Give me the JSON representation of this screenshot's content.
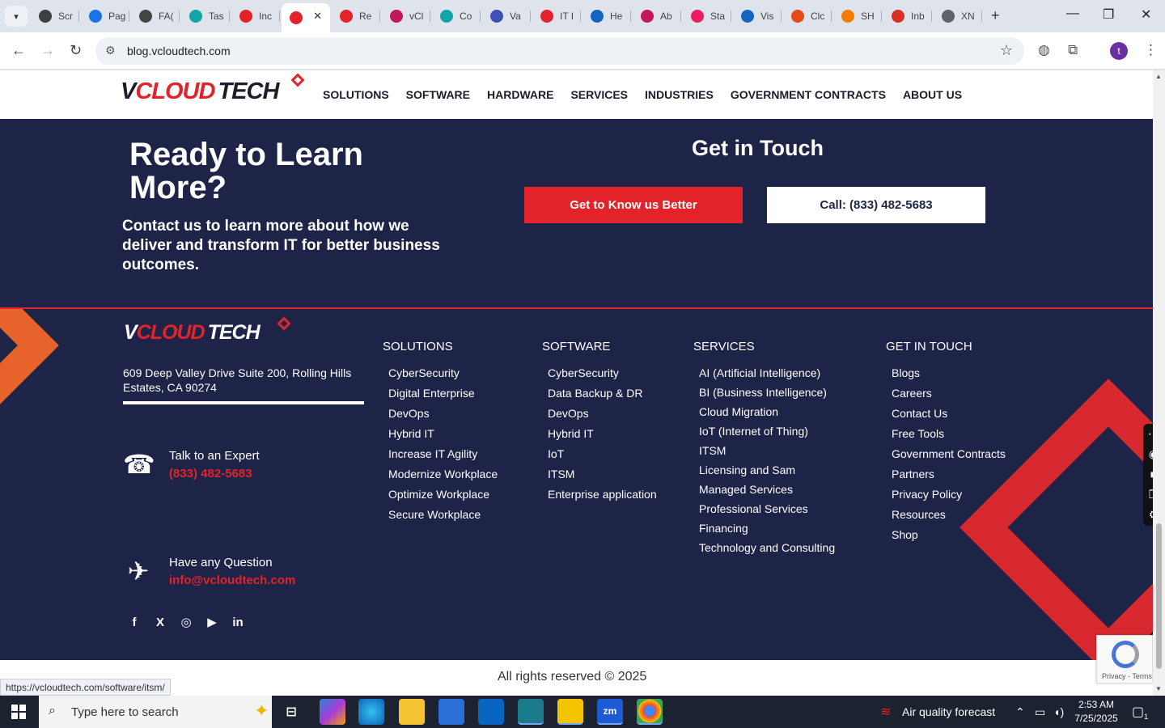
{
  "browser": {
    "tabs": [
      {
        "label": "Scr",
        "color": "#3c4043"
      },
      {
        "label": "Pag",
        "color": "#1a73e8"
      },
      {
        "label": "FA(",
        "color": "#444444"
      },
      {
        "label": "Tas",
        "color": "#12a5a5"
      },
      {
        "label": "Inc",
        "color": "#e2232a"
      },
      {
        "label": "",
        "color": "#e2232a",
        "active": true
      },
      {
        "label": "Re",
        "color": "#e2232a"
      },
      {
        "label": "vCl",
        "color": "#c2185b"
      },
      {
        "label": "Co",
        "color": "#12a5a5"
      },
      {
        "label": "Va",
        "color": "#3f51b5"
      },
      {
        "label": "IT I",
        "color": "#e2232a"
      },
      {
        "label": "He",
        "color": "#1565c0"
      },
      {
        "label": "Ab",
        "color": "#c2185b"
      },
      {
        "label": "Sta",
        "color": "#e91e63"
      },
      {
        "label": "Vis",
        "color": "#1565c0"
      },
      {
        "label": "Clc",
        "color": "#e64a19"
      },
      {
        "label": "SH",
        "color": "#f57c00"
      },
      {
        "label": "Inb",
        "color": "#d93025"
      },
      {
        "label": "XN",
        "color": "#5f6368"
      }
    ],
    "url": "blog.vcloudtech.com",
    "profile_initial": "t"
  },
  "site": {
    "logo": {
      "v": "V",
      "cloud": "CLOUD",
      "tech": "TECH"
    },
    "nav": [
      "SOLUTIONS",
      "SOFTWARE",
      "HARDWARE",
      "SERVICES",
      "INDUSTRIES",
      "GOVERNMENT CONTRACTS",
      "ABOUT US"
    ],
    "cta": {
      "heading": "Ready to Learn More?",
      "text": "Contact us to learn more about how we deliver and transform IT for better business outcomes.",
      "get_in_touch": "Get in Touch",
      "primary_button": "Get to Know us Better",
      "secondary_button": "Call: (833) 482-5683"
    },
    "footer": {
      "address": "609 Deep Valley Drive Suite 200, Rolling Hills Estates, CA 90274",
      "expert_label": "Talk to an Expert",
      "expert_phone": "(833) 482-5683",
      "question_label": "Have any Question",
      "question_email": "info@vcloudtech.com",
      "socials": [
        "f",
        "X",
        "◎",
        "▶",
        "in"
      ],
      "columns": [
        {
          "title": "SOLUTIONS",
          "items": [
            "CyberSecurity",
            "Digital Enterprise",
            "DevOps",
            "Hybrid IT",
            "Increase IT Agility",
            "Modernize Workplace",
            "Optimize Workplace",
            "Secure Workplace"
          ]
        },
        {
          "title": "SOFTWARE",
          "items": [
            "CyberSecurity",
            "Data Backup & DR",
            "DevOps",
            "Hybrid IT",
            "IoT",
            "ITSM",
            "Enterprise application"
          ]
        },
        {
          "title": "SERVICES",
          "items": [
            "AI (Artificial Intelligence)",
            "BI (Business Intelligence)",
            "Cloud Migration",
            "IoT (Internet of Thing)",
            "ITSM",
            "Licensing and Sam",
            "Managed Services",
            "Professional Services",
            "Financing",
            "Technology and Consulting"
          ]
        },
        {
          "title": "GET IN TOUCH",
          "items": [
            "Blogs",
            "Careers",
            "Contact Us",
            "Free Tools",
            "Government Contracts",
            "Partners",
            "Privacy Policy",
            "Resources",
            "Shop"
          ]
        }
      ],
      "copyright": "All rights reserved © 2025"
    },
    "status_url": "https://vcloudtech.com/software/itsm/",
    "recaptcha_text": "Privacy - Terms"
  },
  "taskbar": {
    "search_placeholder": "Type here to search",
    "weather": "Air quality forecast",
    "time": "2:53 AM",
    "date": "7/25/2025",
    "notifications": "1"
  }
}
